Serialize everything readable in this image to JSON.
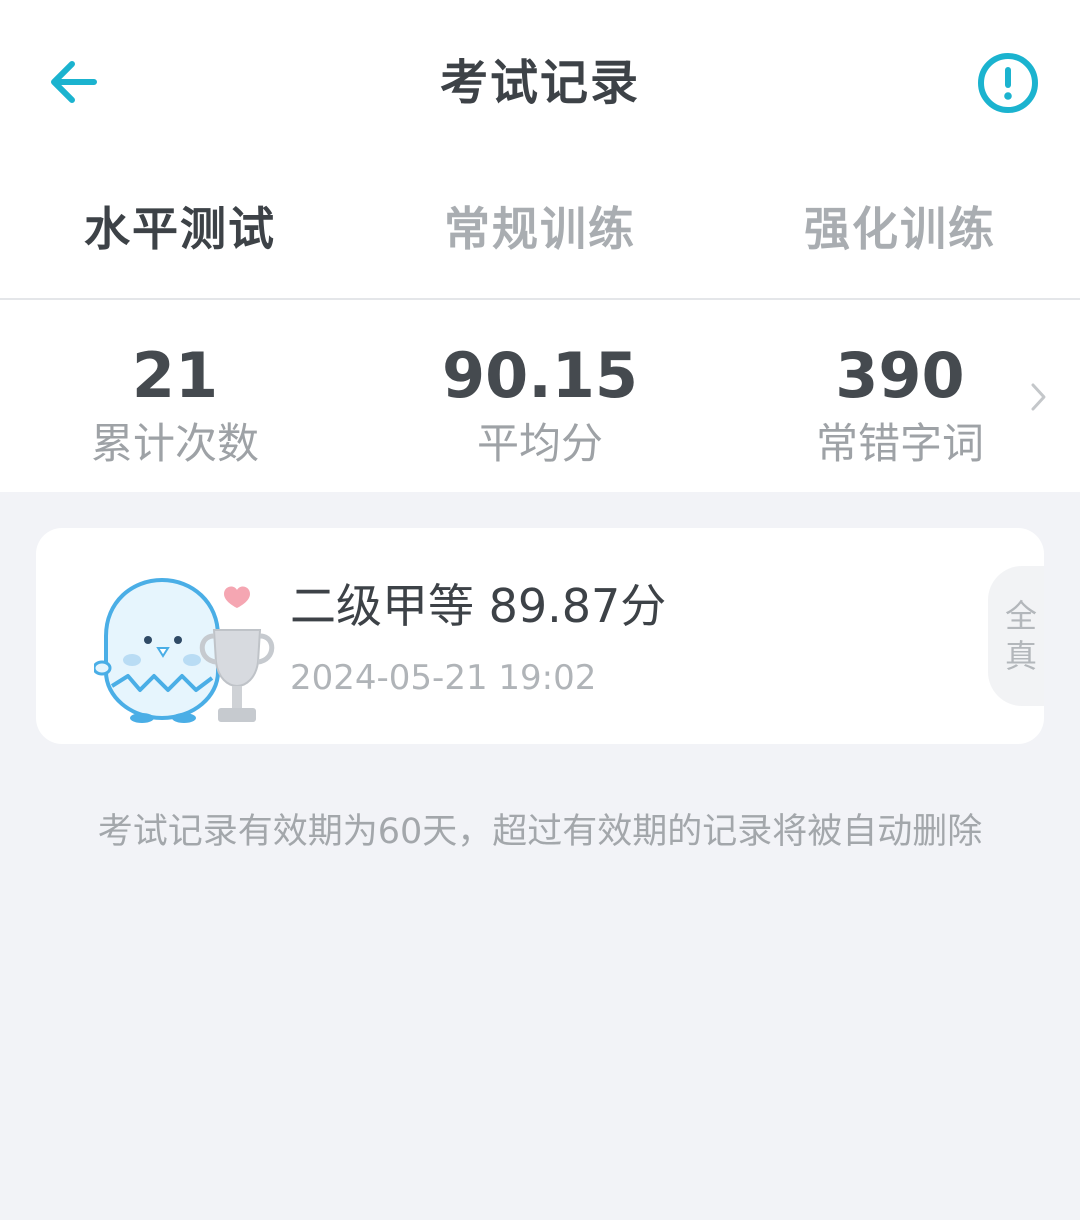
{
  "header": {
    "title": "考试记录",
    "back_icon": "arrow-left-icon",
    "info_icon": "exclamation-circle-icon",
    "accent_color": "#1bb3cf"
  },
  "tabs": [
    {
      "label": "水平测试",
      "active": true
    },
    {
      "label": "常规训练",
      "active": false
    },
    {
      "label": "强化训练",
      "active": false
    }
  ],
  "stats": {
    "items": [
      {
        "value": "21",
        "label": "累计次数"
      },
      {
        "value": "90.15",
        "label": "平均分"
      },
      {
        "value": "390",
        "label": "常错字词"
      }
    ],
    "chevron_icon": "chevron-right-icon"
  },
  "records": [
    {
      "title": "二级甲等 89.87分",
      "time": "2024-05-21 19:02",
      "tag": [
        "全",
        "真"
      ],
      "icon": "mascot-trophy-icon"
    }
  ],
  "notice": "考试记录有效期为60天，超过有效期的记录将被自动删除"
}
